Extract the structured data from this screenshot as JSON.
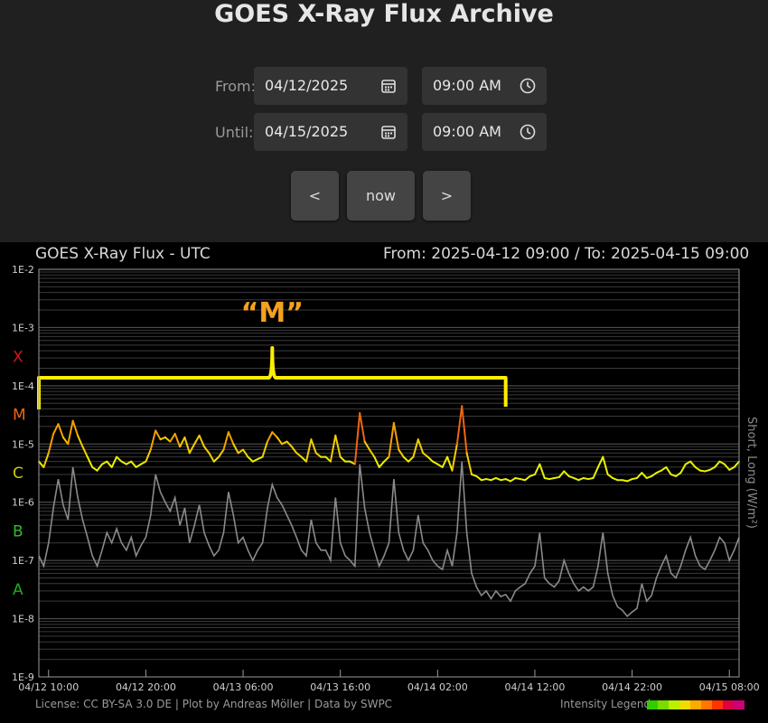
{
  "page": {
    "title": "GOES X-Ray Flux Archive"
  },
  "controls": {
    "from_label": "From:",
    "until_label": "Until:",
    "from_date": "04/12/2025",
    "from_time": "09:00 AM",
    "until_date": "04/15/2025",
    "until_time": "09:00 AM",
    "prev_label": "<",
    "now_label": "now",
    "next_label": ">",
    "icons": [
      "calendar-icon",
      "clock-icon"
    ]
  },
  "chart_header": {
    "left": "GOES X-Ray Flux - UTC",
    "right": "From: 2025-04-12 09:00  /  To: 2025-04-15 09:00"
  },
  "footer": {
    "license": "License: CC BY-SA 3.0 DE | Plot by Andreas Möller | Data by SWPC",
    "legend": "Intensity Legend",
    "legend_colors": [
      "#33cc00",
      "#77dd00",
      "#bbee00",
      "#eedd00",
      "#ffaa00",
      "#ff7700",
      "#ff3300",
      "#dd0044",
      "#cc0077"
    ]
  },
  "annotation": {
    "label": "“M”",
    "x_range": [
      "04/12 09:00",
      "04/14 09:00"
    ],
    "color": "#ffee00"
  },
  "chart_data": {
    "type": "line",
    "y_scale": "log",
    "ylim": [
      1e-09,
      0.01
    ],
    "y_ticks": [
      "1E-2",
      "1E-3",
      "1E-4",
      "1E-5",
      "1E-6",
      "1E-7",
      "1E-8",
      "1E-9"
    ],
    "y_tick_values": [
      0.01,
      0.001,
      0.0001,
      1e-05,
      1e-06,
      1e-07,
      1e-08,
      1e-09
    ],
    "ylabel": "Short, Long (W/m²)",
    "x_ticks": [
      "04/12 10:00",
      "04/12 20:00",
      "04/13 06:00",
      "04/13 16:00",
      "04/14 02:00",
      "04/14 12:00",
      "04/14 22:00",
      "04/15 08:00"
    ],
    "x_tick_hours": [
      1,
      11,
      21,
      31,
      41,
      51,
      61,
      71
    ],
    "x_range_hours": [
      0,
      72
    ],
    "classes": [
      {
        "label": "X",
        "value": 0.00032,
        "color": "#cc1a1a"
      },
      {
        "label": "M",
        "value": 3.2e-05,
        "color": "#ee6611"
      },
      {
        "label": "C",
        "value": 3.2e-06,
        "color": "#cccc00"
      },
      {
        "label": "B",
        "value": 3.2e-07,
        "color": "#33bb33"
      },
      {
        "label": "A",
        "value": 3.2e-08,
        "color": "#22aa22"
      }
    ],
    "series": [
      {
        "name": "Long",
        "color_scale": "class",
        "hours": [
          0,
          0.5,
          1,
          1.5,
          2,
          2.5,
          3,
          3.5,
          4,
          4.5,
          5,
          5.5,
          6,
          6.5,
          7,
          7.5,
          8,
          8.5,
          9,
          9.5,
          10,
          10.5,
          11,
          11.5,
          12,
          12.5,
          13,
          13.5,
          14,
          14.5,
          15,
          15.5,
          16,
          16.5,
          17,
          17.5,
          18,
          18.5,
          19,
          19.5,
          20,
          20.5,
          21,
          21.5,
          22,
          22.5,
          23,
          23.5,
          24,
          24.5,
          25,
          25.5,
          26,
          26.5,
          27,
          27.5,
          28,
          28.5,
          29,
          29.5,
          30,
          30.5,
          31,
          31.5,
          32,
          32.5,
          33,
          33.5,
          34,
          34.5,
          35,
          35.5,
          36,
          36.5,
          37,
          37.5,
          38,
          38.5,
          39,
          39.5,
          40,
          40.5,
          41,
          41.5,
          42,
          42.5,
          43,
          43.5,
          44,
          44.5,
          45,
          45.5,
          46,
          46.5,
          47,
          47.5,
          48,
          48.5,
          49,
          49.5,
          50,
          50.5,
          51,
          51.5,
          52,
          52.5,
          53,
          53.5,
          54,
          54.5,
          55,
          55.5,
          56,
          56.5,
          57,
          57.5,
          58,
          58.5,
          59,
          59.5,
          60,
          60.5,
          61,
          61.5,
          62,
          62.5,
          63,
          63.5,
          64,
          64.5,
          65,
          65.5,
          66,
          66.5,
          67,
          67.5,
          68,
          68.5,
          69,
          69.5,
          70,
          70.5,
          71,
          71.5,
          72
        ],
        "values": [
          5e-06,
          4e-06,
          7e-06,
          1.5e-05,
          2.2e-05,
          1.3e-05,
          1e-05,
          2.5e-05,
          1.4e-05,
          9e-06,
          6e-06,
          4e-06,
          3.5e-06,
          4.5e-06,
          5e-06,
          4e-06,
          6e-06,
          5e-06,
          4.5e-06,
          5e-06,
          4e-06,
          4.5e-06,
          5e-06,
          8e-06,
          1.7e-05,
          1.2e-05,
          1.3e-05,
          1.1e-05,
          1.5e-05,
          9e-06,
          1.3e-05,
          7e-06,
          1e-05,
          1.4e-05,
          9e-06,
          7e-06,
          5e-06,
          6e-06,
          8e-06,
          1.6e-05,
          1e-05,
          7e-06,
          8e-06,
          6e-06,
          5e-06,
          5.5e-06,
          6e-06,
          1.1e-05,
          1.6e-05,
          1.3e-05,
          1e-05,
          1.1e-05,
          9e-06,
          7e-06,
          6e-06,
          5e-06,
          1.2e-05,
          7e-06,
          6e-06,
          6e-06,
          5e-06,
          1.4e-05,
          6e-06,
          5e-06,
          5e-06,
          4.5e-06,
          3.4e-05,
          1.1e-05,
          8e-06,
          6e-06,
          4e-06,
          5e-06,
          6e-06,
          2.3e-05,
          8e-06,
          6e-06,
          5e-06,
          6e-06,
          1.2e-05,
          7e-06,
          6e-06,
          5e-06,
          4.5e-06,
          4e-06,
          6e-06,
          3.5e-06,
          1e-05,
          4.5e-05,
          7e-06,
          3e-06,
          2.8e-06,
          2.4e-06,
          2.5e-06,
          2.4e-06,
          2.6e-06,
          2.4e-06,
          2.5e-06,
          2.3e-06,
          2.6e-06,
          2.5e-06,
          2.4e-06,
          2.8e-06,
          3e-06,
          4.5e-06,
          2.6e-06,
          2.5e-06,
          2.6e-06,
          2.7e-06,
          3.4e-06,
          2.8e-06,
          2.6e-06,
          2.4e-06,
          2.6e-06,
          2.5e-06,
          2.6e-06,
          4e-06,
          6e-06,
          3e-06,
          2.6e-06,
          2.4e-06,
          2.4e-06,
          2.3e-06,
          2.5e-06,
          2.6e-06,
          3.2e-06,
          2.6e-06,
          2.8e-06,
          3.2e-06,
          3.5e-06,
          4e-06,
          3e-06,
          2.8e-06,
          3.2e-06,
          4.5e-06,
          5e-06,
          4e-06,
          3.5e-06,
          3.4e-06,
          3.6e-06,
          4e-06,
          5e-06,
          4.5e-06,
          3.6e-06,
          4e-06,
          5e-06,
          4.5e-06,
          5.5e-06,
          4e-06
        ]
      },
      {
        "name": "Short",
        "color": "#8a8a8a",
        "hours": [
          0,
          0.5,
          1,
          1.5,
          2,
          2.5,
          3,
          3.5,
          4,
          4.5,
          5,
          5.5,
          6,
          6.5,
          7,
          7.5,
          8,
          8.5,
          9,
          9.5,
          10,
          10.5,
          11,
          11.5,
          12,
          12.5,
          13,
          13.5,
          14,
          14.5,
          15,
          15.5,
          16,
          16.5,
          17,
          17.5,
          18,
          18.5,
          19,
          19.5,
          20,
          20.5,
          21,
          21.5,
          22,
          22.5,
          23,
          23.5,
          24,
          24.5,
          25,
          25.5,
          26,
          26.5,
          27,
          27.5,
          28,
          28.5,
          29,
          29.5,
          30,
          30.5,
          31,
          31.5,
          32,
          32.5,
          33,
          33.5,
          34,
          34.5,
          35,
          35.5,
          36,
          36.5,
          37,
          37.5,
          38,
          38.5,
          39,
          39.5,
          40,
          40.5,
          41,
          41.5,
          42,
          42.5,
          43,
          43.5,
          44,
          44.5,
          45,
          45.5,
          46,
          46.5,
          47,
          47.5,
          48,
          48.5,
          49,
          49.5,
          50,
          50.5,
          51,
          51.5,
          52,
          52.5,
          53,
          53.5,
          54,
          54.5,
          55,
          55.5,
          56,
          56.5,
          57,
          57.5,
          58,
          58.5,
          59,
          59.5,
          60,
          60.5,
          61,
          61.5,
          62,
          62.5,
          63,
          63.5,
          64,
          64.5,
          65,
          65.5,
          66,
          66.5,
          67,
          67.5,
          68,
          68.5,
          69,
          69.5,
          70,
          70.5,
          71,
          71.5,
          72
        ],
        "values": [
          1.2e-07,
          8e-08,
          2e-07,
          8e-07,
          2.5e-06,
          9e-07,
          5e-07,
          4e-06,
          1.2e-06,
          5e-07,
          2.5e-07,
          1.2e-07,
          8e-08,
          1.5e-07,
          3e-07,
          2e-07,
          3.5e-07,
          2e-07,
          1.5e-07,
          2.5e-07,
          1.2e-07,
          1.8e-07,
          2.5e-07,
          6e-07,
          3e-06,
          1.5e-06,
          1e-06,
          7e-07,
          1.2e-06,
          4e-07,
          8e-07,
          2e-07,
          4e-07,
          9e-07,
          3e-07,
          1.8e-07,
          1.2e-07,
          1.5e-07,
          3e-07,
          1.5e-06,
          6e-07,
          2e-07,
          2.5e-07,
          1.5e-07,
          1e-07,
          1.5e-07,
          2e-07,
          8e-07,
          2e-06,
          1.2e-06,
          9e-07,
          6e-07,
          4e-07,
          2.5e-07,
          1.5e-07,
          1.2e-07,
          5e-07,
          2e-07,
          1.5e-07,
          1.5e-07,
          1e-07,
          1.2e-06,
          2e-07,
          1.2e-07,
          1e-07,
          8e-08,
          4.5e-06,
          8e-07,
          3e-07,
          1.5e-07,
          8e-08,
          1.2e-07,
          2e-07,
          2.5e-06,
          3e-07,
          1.5e-07,
          1e-07,
          1.5e-07,
          6e-07,
          2e-07,
          1.5e-07,
          1e-07,
          8e-08,
          7e-08,
          1.5e-07,
          8e-08,
          3e-07,
          5e-06,
          3e-07,
          6e-08,
          3.5e-08,
          2.5e-08,
          3e-08,
          2.2e-08,
          3e-08,
          2.4e-08,
          2.6e-08,
          2e-08,
          3e-08,
          3.5e-08,
          4e-08,
          6e-08,
          8e-08,
          3e-07,
          5e-08,
          4e-08,
          3.5e-08,
          4.5e-08,
          1e-07,
          6e-08,
          4e-08,
          3e-08,
          3.5e-08,
          3e-08,
          3.5e-08,
          8e-08,
          3e-07,
          6e-08,
          2.5e-08,
          1.6e-08,
          1.4e-08,
          1.1e-08,
          1.3e-08,
          1.5e-08,
          4e-08,
          2e-08,
          2.5e-08,
          5e-08,
          8e-08,
          1.2e-07,
          6e-08,
          5e-08,
          8e-08,
          1.5e-07,
          2.5e-07,
          1.2e-07,
          8e-08,
          7e-08,
          1e-07,
          1.5e-07,
          2.5e-07,
          2e-07,
          1e-07,
          1.5e-07,
          2.5e-07,
          2e-07,
          3e-07,
          1.5e-07
        ]
      }
    ]
  }
}
